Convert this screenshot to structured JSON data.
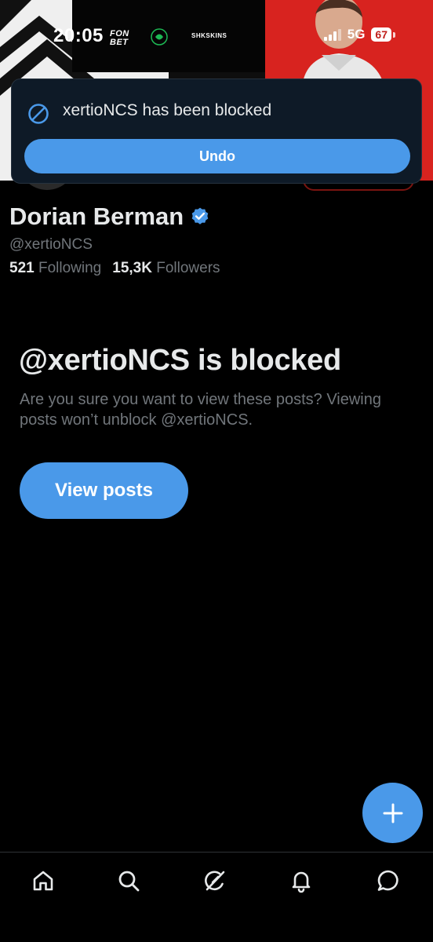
{
  "status_bar": {
    "time": "20:05",
    "network": "5G",
    "battery": "67"
  },
  "banner": {
    "sponsors": {
      "fonbet": "FON\nBET",
      "skins": "SHKSKINS"
    }
  },
  "toast": {
    "message": "xertioNCS has been blocked",
    "undo_label": "Undo"
  },
  "profile": {
    "name": "Dorian Berman",
    "handle": "@xertioNCS",
    "following_count": "521",
    "following_label": "Following",
    "followers_count": "15,3K",
    "followers_label": "Followers"
  },
  "blocked": {
    "title": "@xertioNCS is blocked",
    "description": "Are you sure you want to view these posts? Viewing posts won’t unblock @xertioNCS.",
    "view_posts_label": "View posts"
  },
  "fab": {
    "icon": "plus-icon"
  },
  "bottom_nav": {
    "items": [
      {
        "icon": "home-icon"
      },
      {
        "icon": "search-icon"
      },
      {
        "icon": "grok-icon"
      },
      {
        "icon": "notifications-icon"
      },
      {
        "icon": "messages-icon"
      }
    ]
  },
  "colors": {
    "accent": "#4a99e9",
    "background": "#000000",
    "toast_bg": "#0e1a27",
    "secondary_text": "#71767b",
    "banner_red": "#d8231f"
  }
}
